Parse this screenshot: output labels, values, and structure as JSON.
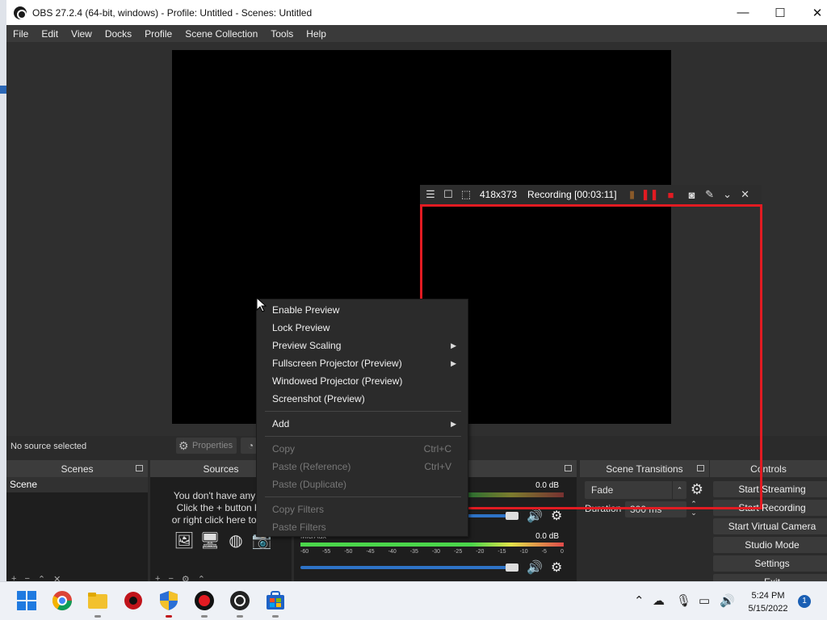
{
  "window": {
    "title": "OBS 27.2.4 (64-bit, windows) - Profile: Untitled - Scenes: Untitled",
    "controls": {
      "minimize": "—",
      "maximize": "☐",
      "close": "✕"
    }
  },
  "menu": [
    "File",
    "Edit",
    "View",
    "Docks",
    "Profile",
    "Scene Collection",
    "Tools",
    "Help"
  ],
  "status": {
    "no_source": "No source selected",
    "properties": "Properties"
  },
  "docks": {
    "scenes": {
      "title": "Scenes",
      "items": [
        "Scene"
      ]
    },
    "sources": {
      "title": "Sources",
      "empty_lines": [
        "You don't have any so",
        "Click the + button be",
        "or right click here to ad"
      ]
    },
    "mixer": {
      "row1": {
        "label": "",
        "db": "0.0 dB"
      },
      "row2": {
        "label": "Mic/Aux",
        "db": "0.0 dB"
      },
      "ticks": [
        "-60",
        "-55",
        "-50",
        "-45",
        "-40",
        "-35",
        "-30",
        "-25",
        "-20",
        "-15",
        "-10",
        "-5",
        "0"
      ]
    },
    "transitions": {
      "title": "Scene Transitions",
      "selected": "Fade",
      "duration_label": "Duration",
      "duration_value": "300 ms"
    },
    "controls": {
      "title": "Controls",
      "buttons": [
        "Start Streaming",
        "Start Recording",
        "Start Virtual Camera",
        "Studio Mode",
        "Settings",
        "Exit"
      ]
    }
  },
  "capture": {
    "size": "418x373",
    "recording": "Recording [00:03:11]",
    "frame_color": "#e21b22"
  },
  "context_menu": {
    "group1": [
      "Enable Preview",
      "Lock Preview",
      "Preview Scaling",
      "Fullscreen Projector (Preview)",
      "Windowed Projector (Preview)",
      "Screenshot (Preview)"
    ],
    "add": "Add",
    "copy": {
      "label": "Copy",
      "shortcut": "Ctrl+C"
    },
    "paste_ref": {
      "label": "Paste (Reference)",
      "shortcut": "Ctrl+V"
    },
    "paste_dup": "Paste (Duplicate)",
    "copy_filters": "Copy Filters",
    "paste_filters": "Paste Filters"
  },
  "taskbar": {
    "time": "5:24 PM",
    "date": "5/15/2022",
    "notifications": "1"
  }
}
